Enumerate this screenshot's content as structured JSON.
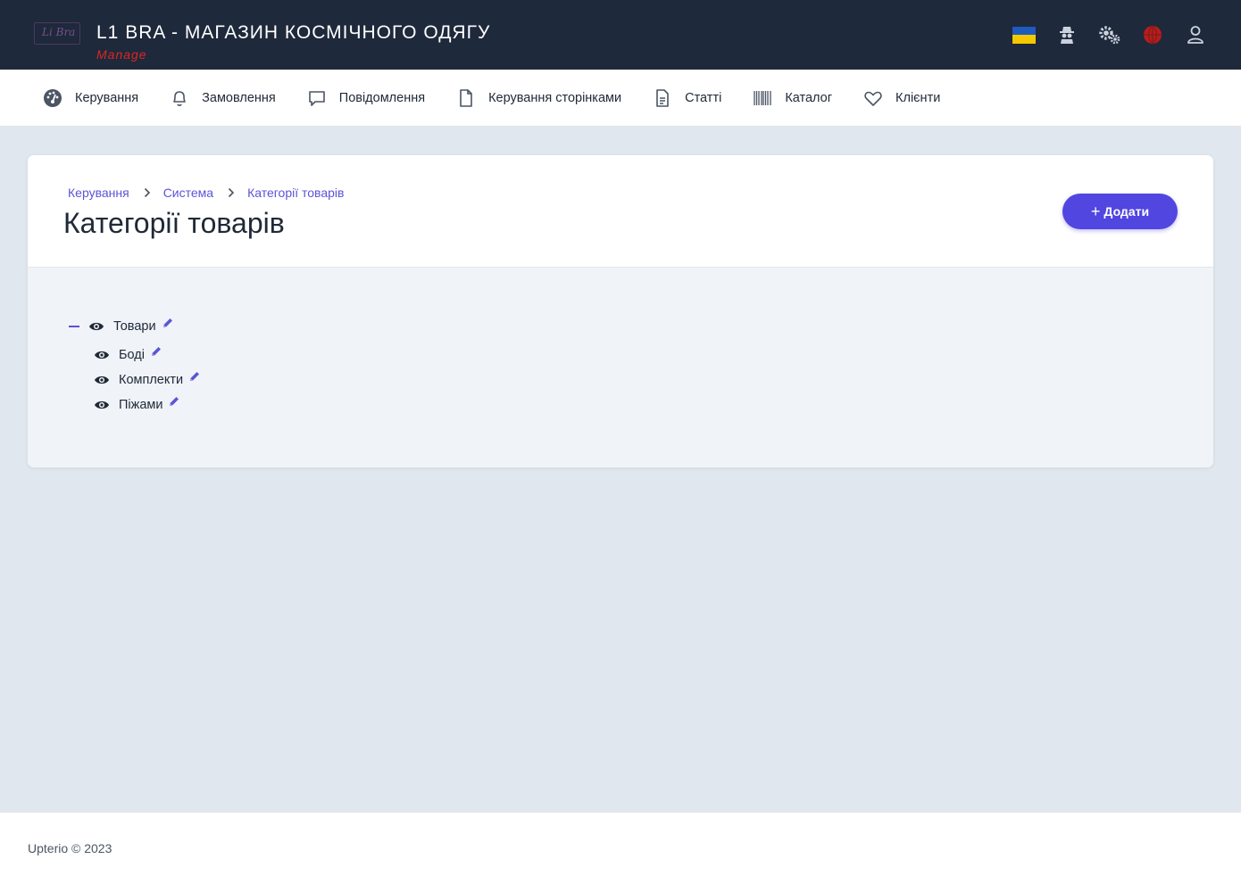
{
  "header": {
    "logo_text": "Li Bra",
    "title": "L1 BRA - МАГАЗИН КОСМІЧНОГО ОДЯГУ",
    "subtitle": "Manage"
  },
  "nav": [
    {
      "icon": "dashboard-icon",
      "label": "Керування"
    },
    {
      "icon": "bell-icon",
      "label": "Замовлення"
    },
    {
      "icon": "message-icon",
      "label": "Повідомлення"
    },
    {
      "icon": "file-icon",
      "label": "Керування сторінками"
    },
    {
      "icon": "document-icon",
      "label": "Статті"
    },
    {
      "icon": "barcode-icon",
      "label": "Каталог"
    },
    {
      "icon": "heart-icon",
      "label": "Клієнти"
    }
  ],
  "breadcrumb": [
    "Керування",
    "Система",
    "Категорії товарів"
  ],
  "page_title": "Категорії товарів",
  "add_button": {
    "label": "Додати"
  },
  "tree": {
    "root": {
      "label": "Товари",
      "expanded": true
    },
    "children": [
      {
        "label": "Боді"
      },
      {
        "label": "Комплекти"
      },
      {
        "label": "Піжами"
      }
    ]
  },
  "colors": {
    "header_bg": "#1e293b",
    "accent": "#5146df",
    "link": "#5b54d6",
    "subtitle_red": "#dc2626"
  },
  "footer": {
    "text": "Upterio © 2023"
  }
}
